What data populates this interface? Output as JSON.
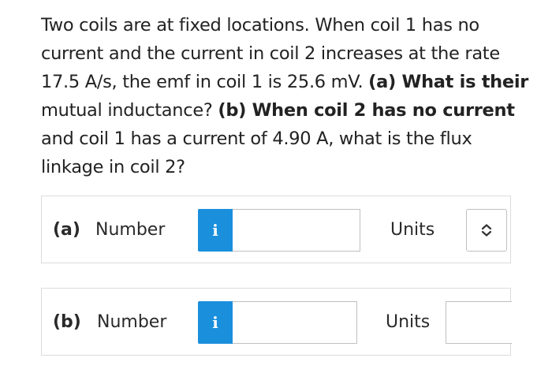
{
  "question": {
    "lines": [
      "Two coils are at fixed locations. When coil 1 has no",
      "current and the current in coil 2 increases at the rate",
      "17.5 A/s, the emf in coil 1 is 25.6 mV. ",
      "(a) What is their",
      "mutual inductance? ",
      "(b) When coil 2 has no current",
      "and coil 1 has a current of 4.90 A, what is the flux",
      "linkage in coil 2?"
    ]
  },
  "part_a": {
    "part_label": "(a)",
    "number_label": "Number",
    "info_icon_glyph": "i",
    "number_value": "",
    "units_label": "Units",
    "units_selected": ""
  },
  "part_b": {
    "part_label": "(b)",
    "number_label": "Number",
    "info_icon_glyph": "i",
    "number_value": "",
    "units_label": "Units",
    "units_selected": ""
  },
  "colors": {
    "info_button": "#1a8fdc",
    "border": "#dcdcdc",
    "text": "#222222"
  },
  "icons": {
    "info": "info-icon",
    "select": "chevron-up-down-icon"
  }
}
